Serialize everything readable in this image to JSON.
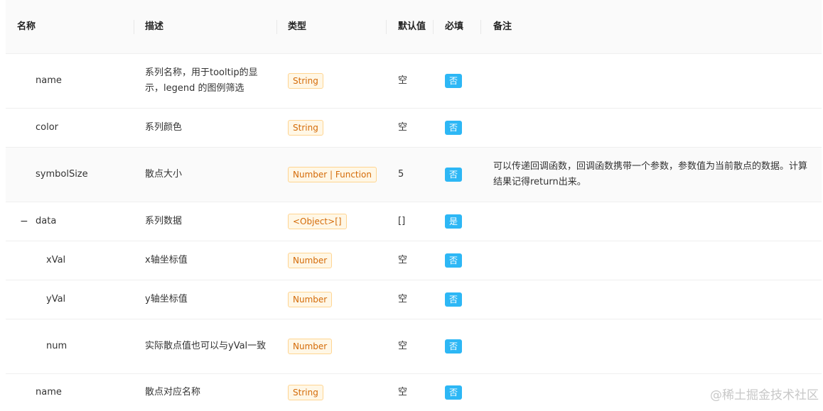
{
  "header": {
    "name": "名称",
    "desc": "描述",
    "type": "类型",
    "default": "默认值",
    "required": "必填",
    "note": "备注"
  },
  "rows": [
    {
      "name": "name",
      "desc": "系列名称，用于tooltip的显示，legend 的图例筛选",
      "type": "String",
      "default": "空",
      "required": "否",
      "note": ""
    },
    {
      "name": "color",
      "desc": "系列颜色",
      "type": "String",
      "default": "空",
      "required": "否",
      "note": ""
    },
    {
      "name": "symbolSize",
      "desc": "散点大小",
      "type": "Number | Function",
      "default": "5",
      "required": "否",
      "note": "可以传递回调函数，回调函数携带一个参数，参数值为当前散点的数据。计算结果记得return出来。"
    },
    {
      "name": "data",
      "expand": "−",
      "desc": "系列数据",
      "type": "<Object>[]",
      "default": "[]",
      "required": "是",
      "note": ""
    },
    {
      "name": "xVal",
      "desc": "x轴坐标值",
      "type": "Number",
      "default": "空",
      "required": "否",
      "note": ""
    },
    {
      "name": "yVal",
      "desc": "y轴坐标值",
      "type": "Number",
      "default": "空",
      "required": "否",
      "note": ""
    },
    {
      "name": "num",
      "desc": "实际散点值也可以与yVal一致",
      "type": "Number",
      "default": "空",
      "required": "否",
      "note": ""
    },
    {
      "name": "name",
      "desc": "散点对应名称",
      "type": "String",
      "default": "空",
      "required": "否",
      "note": ""
    }
  ],
  "watermark": "@稀土掘金技术社区"
}
